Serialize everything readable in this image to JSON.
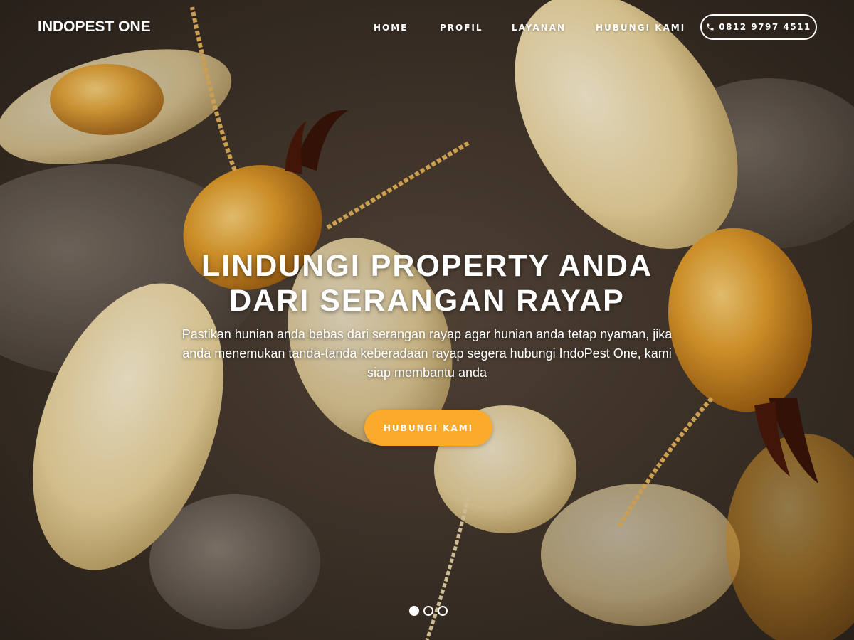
{
  "brand": {
    "name": "INDOPEST ONE"
  },
  "nav": {
    "items": [
      {
        "label": "HOME"
      },
      {
        "label": "PROFIL"
      },
      {
        "label": "LAYANAN"
      },
      {
        "label": "HUBUNGI KAMI"
      }
    ],
    "phone": {
      "icon": "phone-icon",
      "label": "0812 9797 4511"
    }
  },
  "hero": {
    "title_line1": "LINDUNGI PROPERTY ANDA",
    "title_line2": "DARI SERANGAN RAYAP",
    "text": "Pastikan hunian anda bebas dari serangan rayap agar hunian anda tetap nyaman, jika anda menemukan tanda-tanda keberadaan rayap segera hubungi IndoPest One, kami siap membantu anda",
    "cta_label": "HUBUNGI KAMI",
    "background": "termite-photo"
  },
  "slider": {
    "total_slides": 3,
    "active_index": 0
  },
  "colors": {
    "accent": "#fbaa2b",
    "text": "#ffffff"
  }
}
